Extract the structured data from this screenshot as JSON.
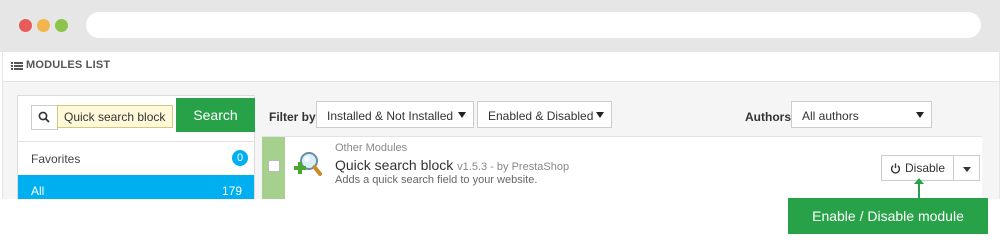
{
  "panel": {
    "title": "MODULES LIST",
    "title_icon": "list-icon"
  },
  "search": {
    "value": "Quick search block",
    "button_label": "Search",
    "icon": "search-icon"
  },
  "categories": [
    {
      "label": "Favorites",
      "count": "0"
    },
    {
      "label": "All",
      "count": "179",
      "active": true
    }
  ],
  "filter": {
    "label": "Filter by",
    "install_status": "Installed & Not Installed",
    "enabled_status": "Enabled & Disabled",
    "authors_label": "Authors",
    "authors_value": "All authors"
  },
  "module": {
    "category": "Other Modules",
    "name": "Quick search block",
    "meta": "v1.5.3 - by PrestaShop",
    "description": "Adds a quick search field to your website.",
    "action_label": "Disable",
    "action_icon": "power-icon"
  },
  "callout": {
    "text": "Enable / Disable module"
  },
  "colors": {
    "accent_green": "#27a249",
    "accent_blue": "#00aff0",
    "check_green": "#a6d08d"
  }
}
